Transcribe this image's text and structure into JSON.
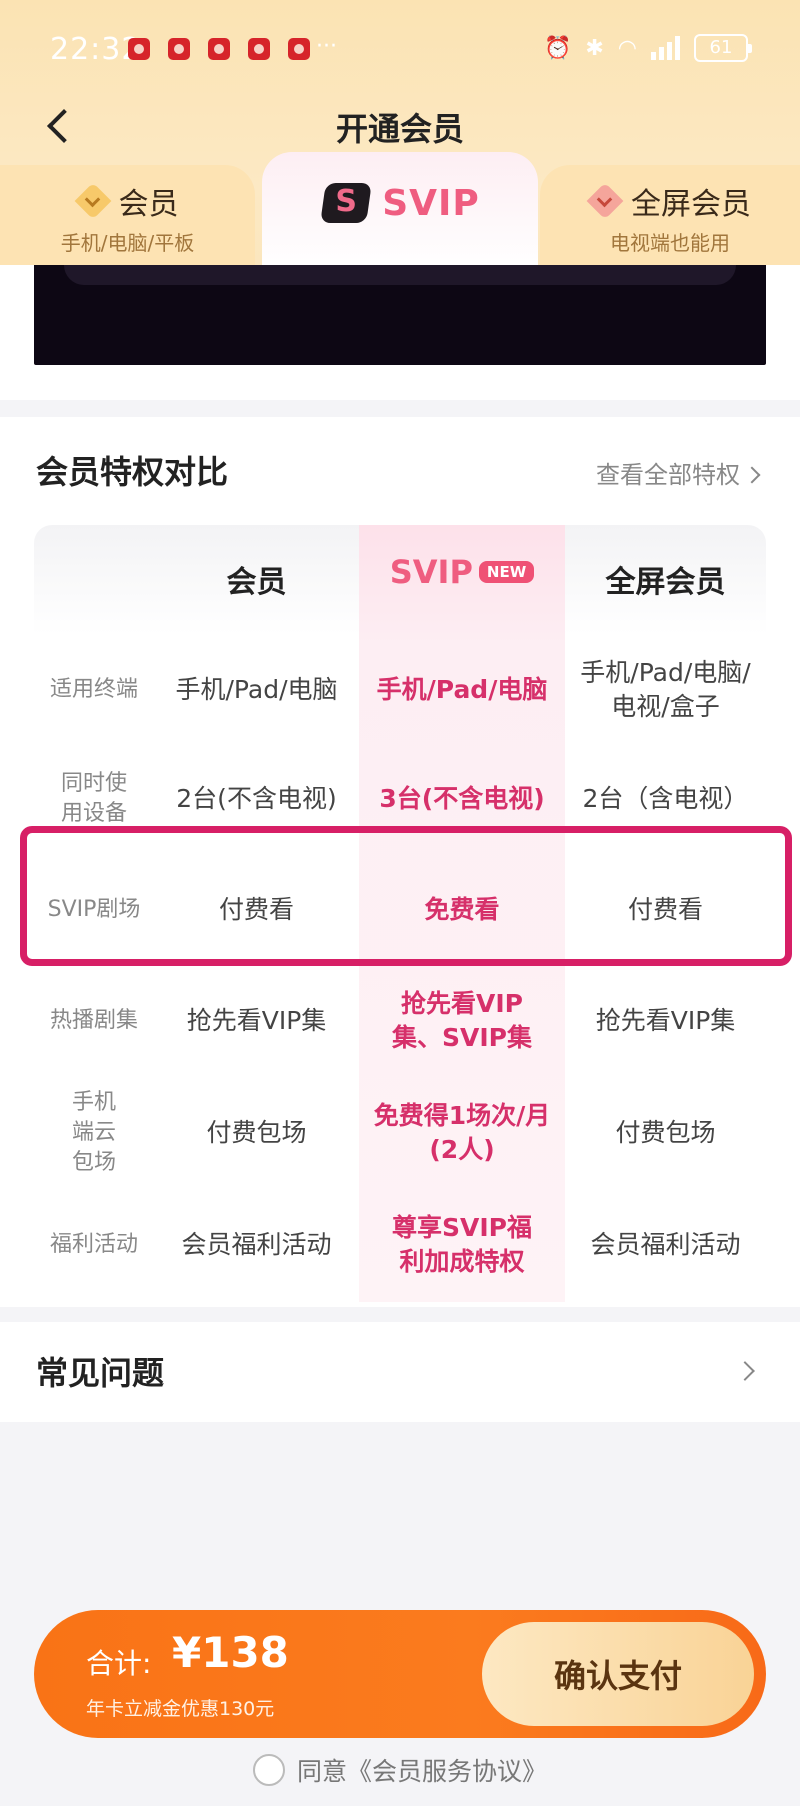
{
  "status_bar": {
    "time": "22:32",
    "battery": "61",
    "more": "···"
  },
  "nav": {
    "title": "开通会员"
  },
  "tabs": [
    {
      "title": "会员",
      "subtitle": "手机/电脑/平板",
      "icon": "heart-gold-icon"
    },
    {
      "title": "SVIP",
      "badge": "S",
      "icon": "svip-badge-icon"
    },
    {
      "title": "全屏会员",
      "subtitle": "电视端也能用",
      "icon": "heart-pink-icon"
    }
  ],
  "compare": {
    "title": "会员特权对比",
    "view_all": "查看全部特权",
    "columns": [
      "会员",
      "SVIP",
      "全屏会员"
    ],
    "new_tag": "NEW",
    "rows": [
      {
        "label": "适用终端",
        "member": "手机/Pad/电脑",
        "svip": "手机/Pad/电脑",
        "full": "手机/Pad/电脑/电视/盒子"
      },
      {
        "label": "同时使用设备",
        "member": "2台(不含电视)",
        "svip": "3台(不含电视)",
        "full": "2台（含电视）"
      },
      {
        "label": "SVIP剧场",
        "member": "付费看",
        "svip": "免费看",
        "full": "付费看"
      },
      {
        "label": "热播剧集",
        "member": "抢先看VIP集",
        "svip": "抢先看VIP集、SVIP集",
        "full": "抢先看VIP集"
      },
      {
        "label": "手机端云包场",
        "member": "付费包场",
        "svip": "免费得1场次/月(2人)",
        "full": "付费包场"
      },
      {
        "label": "福利活动",
        "member": "会员福利活动",
        "svip": "尊享SVIP福利加成特权",
        "full": "会员福利活动"
      }
    ]
  },
  "faq": {
    "title": "常见问题"
  },
  "pay": {
    "total_label": "合计:",
    "total_amount": "¥138",
    "discount": "年卡立减金优惠130元",
    "confirm": "确认支付",
    "agree": "同意《会员服务协议》"
  },
  "colors": {
    "accent_pink": "#ef5d80",
    "pay_orange": "#f97316",
    "highlight": "#d71f66"
  }
}
